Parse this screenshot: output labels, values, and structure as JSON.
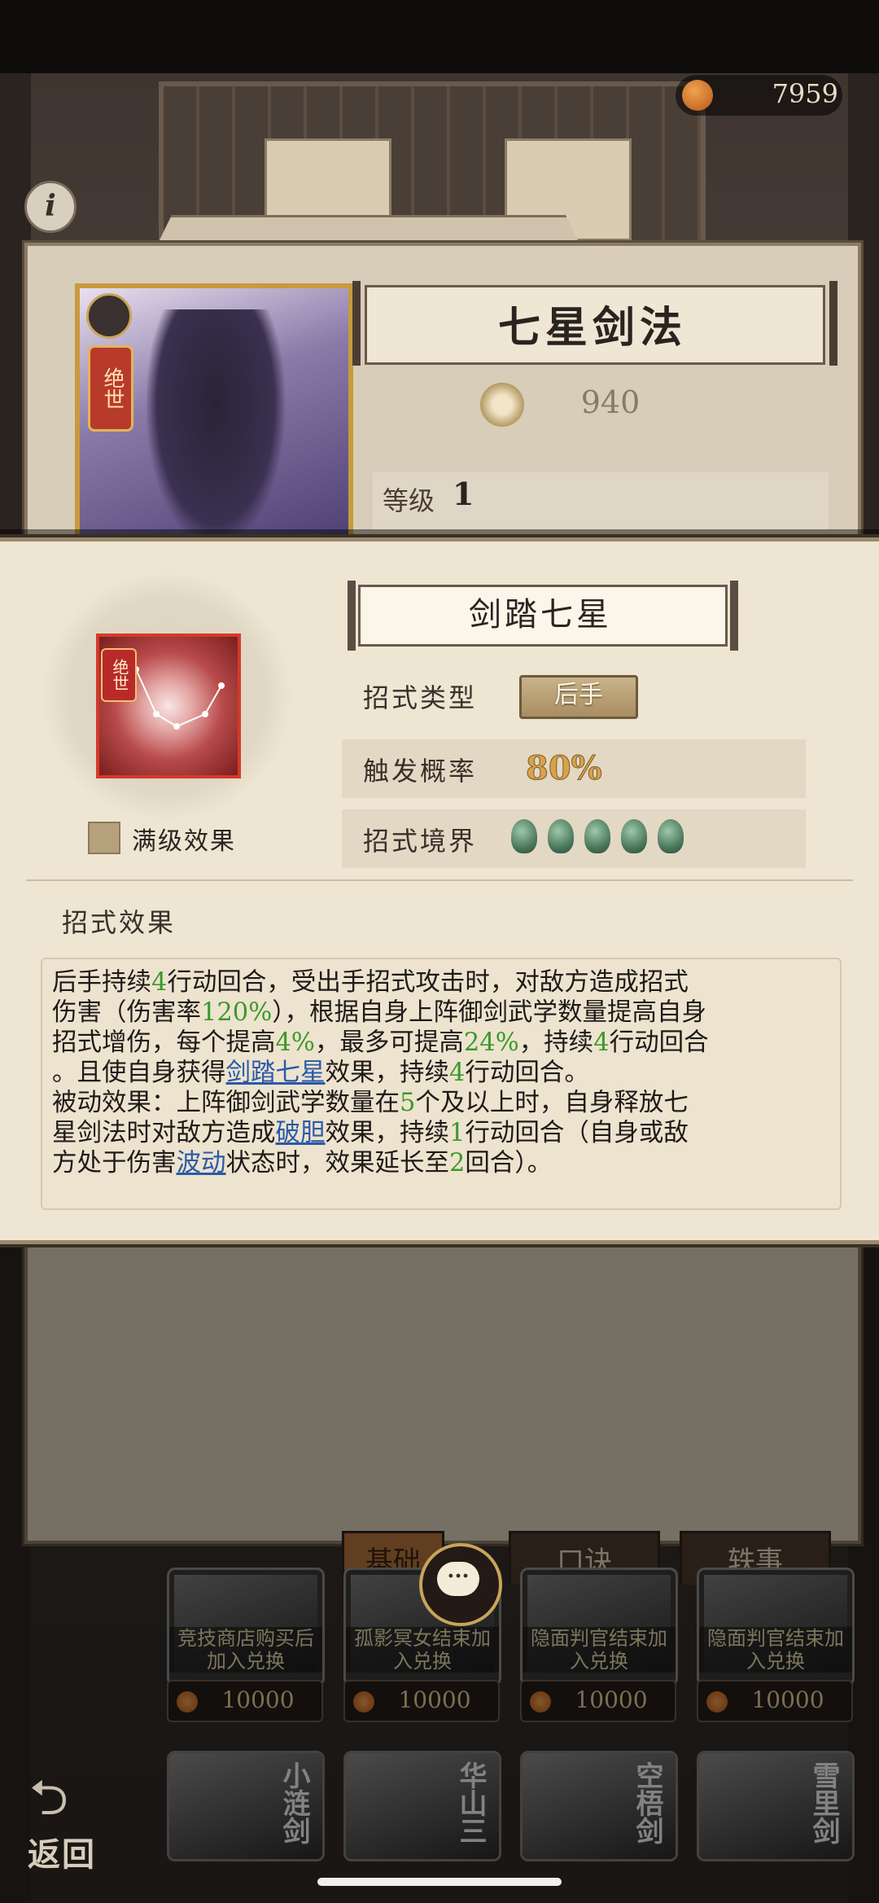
{
  "currency": {
    "value": "7959",
    "icon": "copper-coin-icon"
  },
  "info_button": {
    "label": "i"
  },
  "card": {
    "portrait_tag": "绝世",
    "title": "七星剑法",
    "power": "940",
    "level_label": "等级",
    "level_value": "1"
  },
  "popup": {
    "title": "剑踏七星",
    "icon_tag": "绝世",
    "max_level_label": "满级效果",
    "type_label": "招式类型",
    "type_value": "后手",
    "prob_label": "触发概率",
    "prob_value": "80%",
    "realm_label": "招式境界",
    "realm_count": 5,
    "effect_heading": "招式效果",
    "effect_parts": [
      {
        "t": "后手持续"
      },
      {
        "t": "4",
        "c": "g"
      },
      {
        "t": "行动回合，受出手招式攻击时，对敌方造成招式\n伤害（伤害率"
      },
      {
        "t": "120%",
        "c": "g"
      },
      {
        "t": "），根据自身上阵御剑武学数量提高自身\n招式增伤，每个提高"
      },
      {
        "t": "4%",
        "c": "g"
      },
      {
        "t": "，最多可提高"
      },
      {
        "t": "24%",
        "c": "g"
      },
      {
        "t": "，持续"
      },
      {
        "t": "4",
        "c": "g"
      },
      {
        "t": "行动回合\n。且使自身获得"
      },
      {
        "t": "剑踏七星",
        "c": "l"
      },
      {
        "t": "效果，持续"
      },
      {
        "t": "4",
        "c": "g"
      },
      {
        "t": "行动回合。\n被动效果：上阵御剑武学数量在"
      },
      {
        "t": "5",
        "c": "g"
      },
      {
        "t": "个及以上时，自身释放七\n星剑法时对敌方造成"
      },
      {
        "t": "破胆",
        "c": "l"
      },
      {
        "t": "效果，持续"
      },
      {
        "t": "1",
        "c": "g"
      },
      {
        "t": "行动回合（自身或敌\n方处于伤害"
      },
      {
        "t": "波动",
        "c": "l"
      },
      {
        "t": "状态时，效果延长至"
      },
      {
        "t": "2",
        "c": "g"
      },
      {
        "t": "回合）。"
      }
    ]
  },
  "tabs": [
    "基础",
    "口诀",
    "轶事"
  ],
  "shop_items": [
    {
      "text": "竞技商店购买后加入兑换",
      "price": "10000"
    },
    {
      "text": "孤影冥女结束加入兑换",
      "price": "10000"
    },
    {
      "text": "隐面判官结束加入兑换",
      "price": "10000"
    },
    {
      "text": "隐面判官结束加入兑换",
      "price": "10000"
    }
  ],
  "lower_items": [
    "小涟剑",
    "华山三",
    "空梧剑",
    "雪里剑"
  ],
  "back_button": {
    "label": "返回"
  }
}
